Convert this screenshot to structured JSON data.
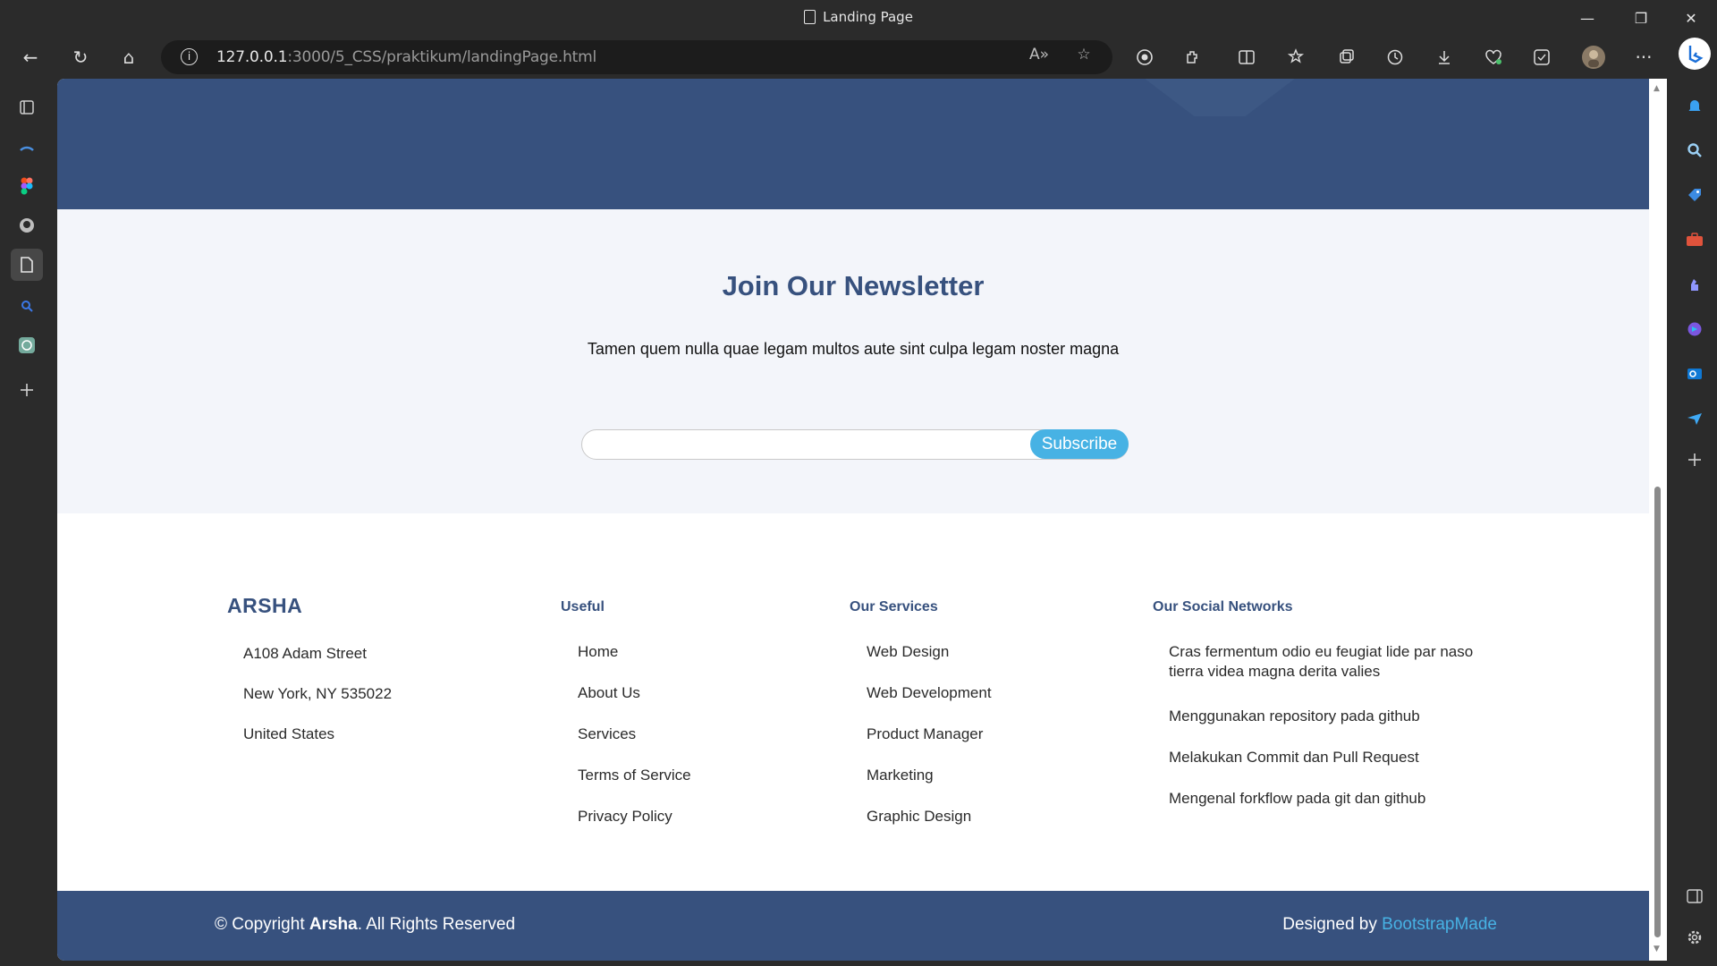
{
  "window": {
    "tab_title": "Landing Page",
    "minimize": "—",
    "restore": "❐",
    "close": "✕"
  },
  "toolbar": {
    "url_host": "127.0.0.1",
    "url_rest": ":3000/5_CSS/praktikum/landingPage.html",
    "info_glyph": "i",
    "back": "←",
    "reload": "↻",
    "home": "⌂",
    "read_aloud": "A»",
    "favorite": "☆",
    "more": "···"
  },
  "newsletter": {
    "title": "Join Our Newsletter",
    "text": "Tamen quem nulla quae legam multos aute sint culpa legam noster magna",
    "input_value": "",
    "button_label": "Subscribe"
  },
  "footer": {
    "brand": "ARSHA",
    "address": [
      "A108 Adam Street",
      "New York, NY 535022",
      "United States"
    ],
    "useful": {
      "heading": "Useful",
      "items": [
        "Home",
        "About Us",
        "Services",
        "Terms of Service",
        "Privacy Policy"
      ]
    },
    "services": {
      "heading": "Our Services",
      "items": [
        "Web Design",
        "Web Development",
        "Product Manager",
        "Marketing",
        "Graphic Design"
      ]
    },
    "social": {
      "heading": "Our Social Networks",
      "items": [
        "Cras fermentum odio eu feugiat lide par naso tierra videa magna derita valies",
        "Menggunakan repository pada github",
        "Melakukan Commit dan Pull Request",
        "Mengenal forkflow pada git dan github"
      ]
    },
    "copyright_prefix": "© Copyright ",
    "copyright_brand": "Arsha",
    "copyright_suffix": ". All Rights Reserved",
    "designed_prefix": "Designed by ",
    "designed_link": "BootstrapMade"
  },
  "colors": {
    "primary": "#37517e",
    "accent": "#47b2e4",
    "newsletter_bg": "#f3f5fa"
  }
}
